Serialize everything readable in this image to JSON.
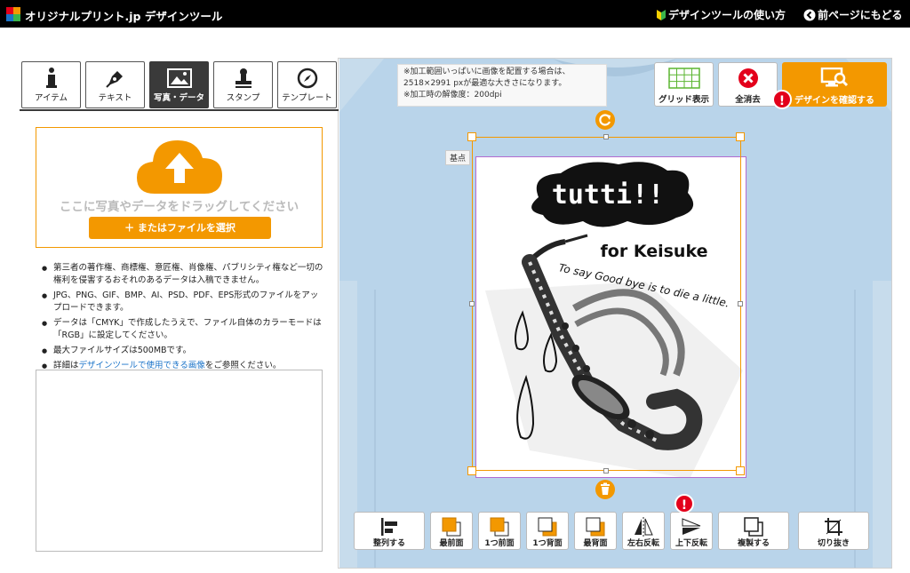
{
  "header": {
    "title": "オリジナルプリント.jp デザインツール",
    "help_label": "デザインツールの使い方",
    "back_label": "前ページにもどる"
  },
  "tabs": [
    {
      "label": "アイテム",
      "icon": "info-icon"
    },
    {
      "label": "テキスト",
      "icon": "pen-icon"
    },
    {
      "label": "写真・データ",
      "icon": "image-icon",
      "active": true
    },
    {
      "label": "スタンプ",
      "icon": "stamp-icon"
    },
    {
      "label": "テンプレート",
      "icon": "compass-icon"
    }
  ],
  "upload": {
    "drop_text": "ここに写真やデータをドラッグしてください",
    "file_button": "＋ またはファイルを選択"
  },
  "notes": [
    "第三者の著作権、商標権、意匠権、肖像権、パブリシティ権など一切の権利を侵害するおそれのあるデータは入稿できません。",
    "JPG、PNG、GIF、BMP、AI、PSD、PDF、EPS形式のファイルをアップロードできます。",
    "データは「CMYK」で作成したうえで、ファイル自体のカラーモードは「RGB」に設定してください。",
    "最大ファイルサイズは500MBです。"
  ],
  "note_link": {
    "prefix": "詳細は",
    "link": "デザインツールで使用できる画像",
    "suffix": "をご参照ください。"
  },
  "info": {
    "line1": "※加工範囲いっぱいに画像を配置する場合は、",
    "line2": "2518×2991 pxが最適な大きさになります。",
    "line3": "※加工時の解像度：200dpi"
  },
  "toolbar": {
    "grid_label": "グリッド表示",
    "clear_label": "全消去",
    "confirm_label": "デザインを確認する"
  },
  "canvas": {
    "base_label": "基点",
    "art_title": "tutti!!",
    "art_subtitle": "for Keisuke",
    "art_phrase": "To say Good bye is to die a little."
  },
  "bottom_buttons": [
    {
      "label": "整列する",
      "icon": "align-icon"
    },
    {
      "label": "最前面",
      "icon": "bring-front-icon"
    },
    {
      "label": "1つ前面",
      "icon": "bring-forward-icon"
    },
    {
      "label": "1つ背面",
      "icon": "send-backward-icon"
    },
    {
      "label": "最背面",
      "icon": "send-back-icon"
    },
    {
      "label": "左右反転",
      "icon": "flip-horizontal-icon"
    },
    {
      "label": "上下反転",
      "icon": "flip-vertical-icon"
    },
    {
      "label": "複製する",
      "icon": "duplicate-icon"
    },
    {
      "label": "切り抜き",
      "icon": "crop-icon"
    }
  ],
  "colors": {
    "accent": "#f39800",
    "alert": "#e3001b",
    "canvas_bg": "#c7dcec",
    "link": "#1a73c8"
  }
}
